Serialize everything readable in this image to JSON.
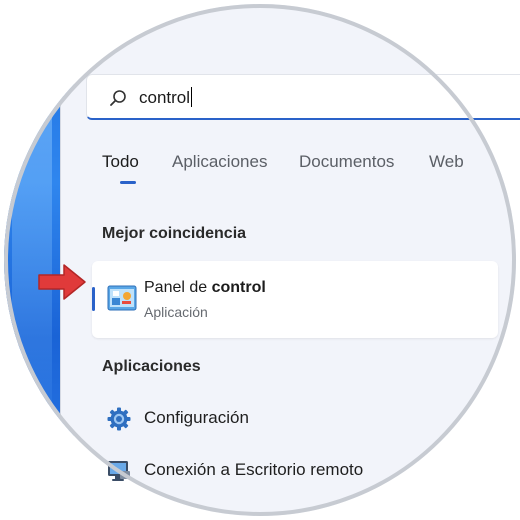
{
  "search": {
    "value": "control"
  },
  "tabs": [
    {
      "label": "Todo",
      "active": true
    },
    {
      "label": "Aplicaciones",
      "active": false
    },
    {
      "label": "Documentos",
      "active": false
    },
    {
      "label": "Web",
      "active": false
    }
  ],
  "best_match": {
    "heading": "Mejor coincidencia",
    "name_prefix": "Panel de ",
    "name_highlight": "control",
    "subtitle": "Aplicación",
    "icon": "control-panel-icon"
  },
  "apps": {
    "heading": "Aplicaciones",
    "items": [
      {
        "label": "Configuración",
        "icon": "settings-gear-icon"
      },
      {
        "label": "Conexión a Escritorio remoto",
        "icon": "remote-desktop-icon"
      }
    ]
  },
  "colors": {
    "accent": "#2a62c9",
    "arrow": "#e03a3a",
    "panel_bg": "#f2f4fa"
  }
}
